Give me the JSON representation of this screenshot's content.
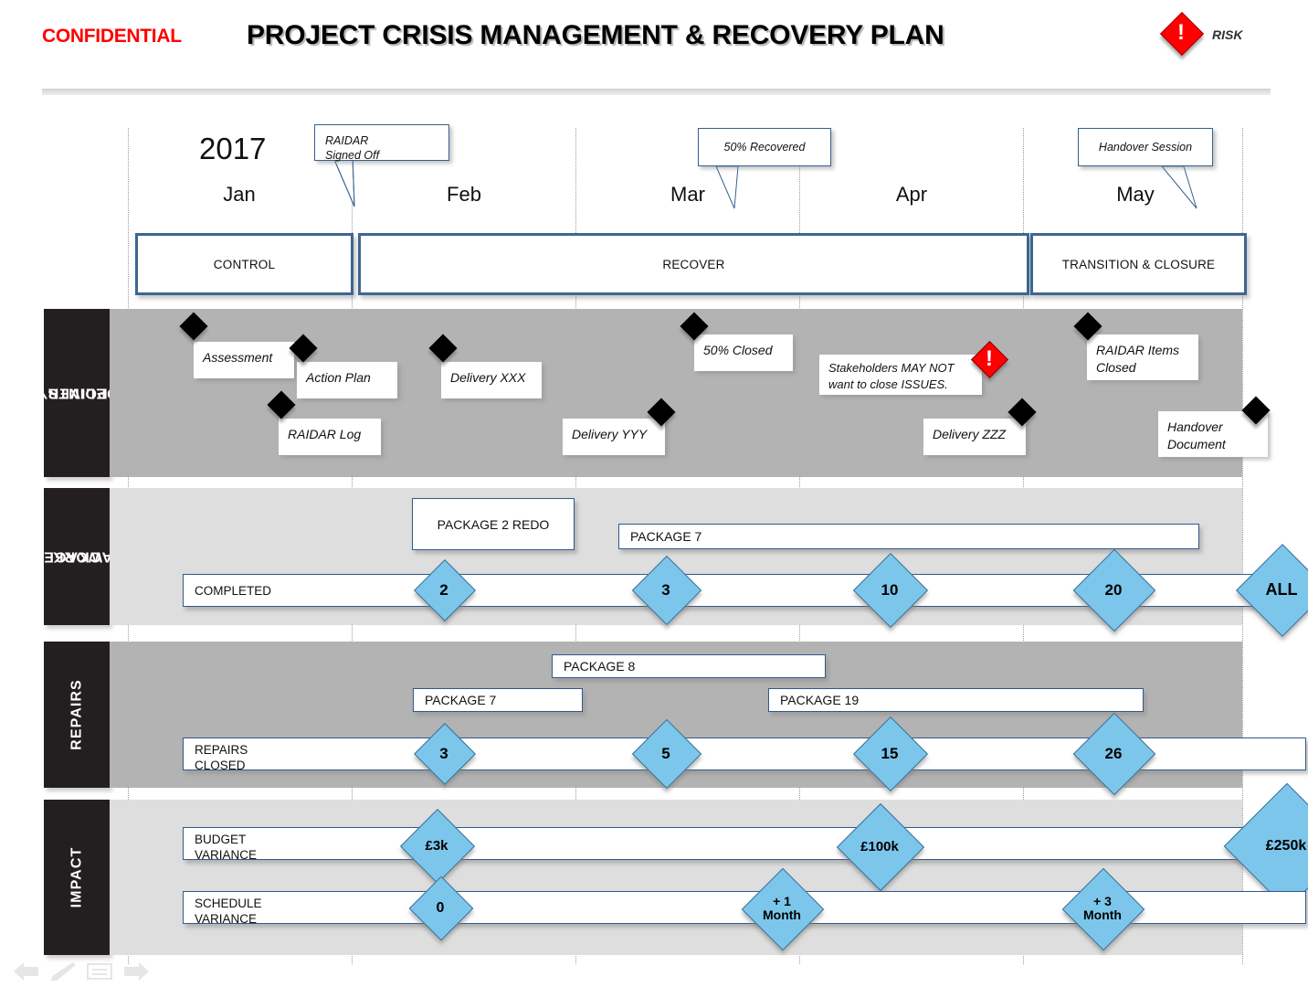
{
  "header": {
    "confidential": "CONFIDENTIAL",
    "title": "PROJECT CRISIS MANAGEMENT & RECOVERY PLAN",
    "risk_legend_label": "RISK",
    "risk_icon": "risk-diamond-icon",
    "risk_glyph": "!"
  },
  "timeline": {
    "year": "2017",
    "months": [
      "Jan",
      "Feb",
      "Mar",
      "Apr",
      "May"
    ],
    "callouts": [
      {
        "text": "RAIDAR\nSigned Off",
        "line1": "RAIDAR",
        "line2": "Signed Off"
      },
      {
        "text": "50% Recovered",
        "line1": "50% Recovered",
        "line2": ""
      },
      {
        "text": "Handover Session",
        "line1": "Handover Session",
        "line2": ""
      }
    ],
    "phases": [
      {
        "label": "CONTROL"
      },
      {
        "label": "RECOVER"
      },
      {
        "label": "TRANSITION  & CLOSURE"
      }
    ]
  },
  "bands": {
    "delivery_points": {
      "label": "DELIVERY\nPOINTS",
      "label_line1": "DELIVERY",
      "label_line2": "POINTS",
      "milestones": [
        {
          "label": "Assessment",
          "line2": ""
        },
        {
          "label": "Action Plan",
          "line2": ""
        },
        {
          "label": "RAIDAR Log",
          "line2": ""
        },
        {
          "label": "Delivery XXX",
          "line2": ""
        },
        {
          "label": "Delivery  YYY",
          "line2": ""
        },
        {
          "label": "50% Closed",
          "line2": ""
        },
        {
          "label": "Delivery  ZZZ",
          "line2": ""
        },
        {
          "label": "RAIDAR  Items",
          "line2": "Closed"
        },
        {
          "label": "Handover",
          "line2": "Document"
        }
      ],
      "risk_note": {
        "line1": "Stakeholders MAY NOT",
        "line2": "want to close ISSUES."
      }
    },
    "work_packages": {
      "label": "WORK\nPACKAGES",
      "label_line1": "WORK",
      "label_line2": "PACKAGES",
      "packages": [
        {
          "label": "PACKAGE  2 REDO"
        },
        {
          "label": "PACKAGE  7"
        }
      ],
      "metric": {
        "label": "COMPLETED"
      },
      "markers": [
        "2",
        "3",
        "10",
        "20",
        "ALL"
      ]
    },
    "repairs": {
      "label": "REPAIRS",
      "packages": [
        {
          "label": "PACKAGE 8"
        },
        {
          "label": "PACKAGE 7"
        },
        {
          "label": "PACKAGE 19"
        }
      ],
      "metric": {
        "line1": "REPAIRS",
        "line2": "CLOSED"
      },
      "markers": [
        "3",
        "5",
        "15",
        "26"
      ]
    },
    "impact": {
      "label": "IMPACT",
      "budget": {
        "line1": "BUDGET",
        "line2": "VARIANCE",
        "markers": [
          "£3k",
          "£100k",
          "£250k"
        ]
      },
      "schedule": {
        "line1": "SCHEDULE",
        "line2": "VARIANCE",
        "markers": [
          {
            "line1": "0",
            "line2": ""
          },
          {
            "line1": "+ 1",
            "line2": "Month"
          },
          {
            "line1": "+ 3",
            "line2": "Month"
          }
        ]
      }
    }
  },
  "bottom_icons": [
    "back-arrow-icon",
    "pencil-icon",
    "lines-icon",
    "forward-arrow-icon"
  ],
  "colors": {
    "confidential_red": "#ff0000",
    "risk_red": "#ff0000",
    "phase_border_blue": "#3d678f",
    "diamond_blue": "#7cc6ec",
    "band_label_dark": "#231f20",
    "delivery_band_bg": "#b3b3b3",
    "work_band_bg": "#dedede"
  }
}
